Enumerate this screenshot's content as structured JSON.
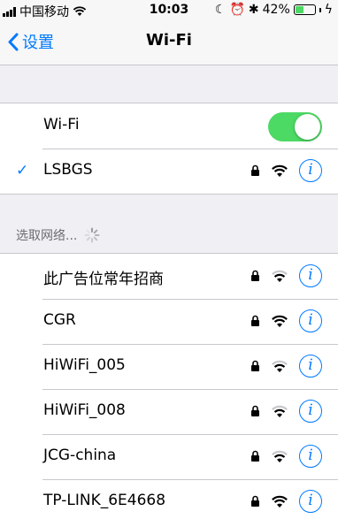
{
  "status_bar": {
    "carrier": "中国移动",
    "time": "10:03",
    "battery_percent": "42%",
    "battery_level": 0.42,
    "accent_battery_color": "#4cd964"
  },
  "nav": {
    "back_label": "设置",
    "title": "Wi-Fi"
  },
  "wifi_toggle": {
    "label": "Wi-Fi",
    "on": true
  },
  "connected_network": {
    "name": "LSBGS",
    "locked": true,
    "signal": 3
  },
  "section": {
    "header": "选取网络..."
  },
  "networks": [
    {
      "name": "此广告位常年招商",
      "locked": true,
      "signal": 2
    },
    {
      "name": "CGR",
      "locked": true,
      "signal": 3
    },
    {
      "name": "HiWiFi_005",
      "locked": true,
      "signal": 2
    },
    {
      "name": "HiWiFi_008",
      "locked": true,
      "signal": 2
    },
    {
      "name": "JCG-china",
      "locked": true,
      "signal": 2
    },
    {
      "name": "TP-LINK_6E4668",
      "locked": true,
      "signal": 3
    }
  ],
  "colors": {
    "accent": "#007aff",
    "toggle_on": "#4cd964",
    "background": "#efeff4"
  }
}
